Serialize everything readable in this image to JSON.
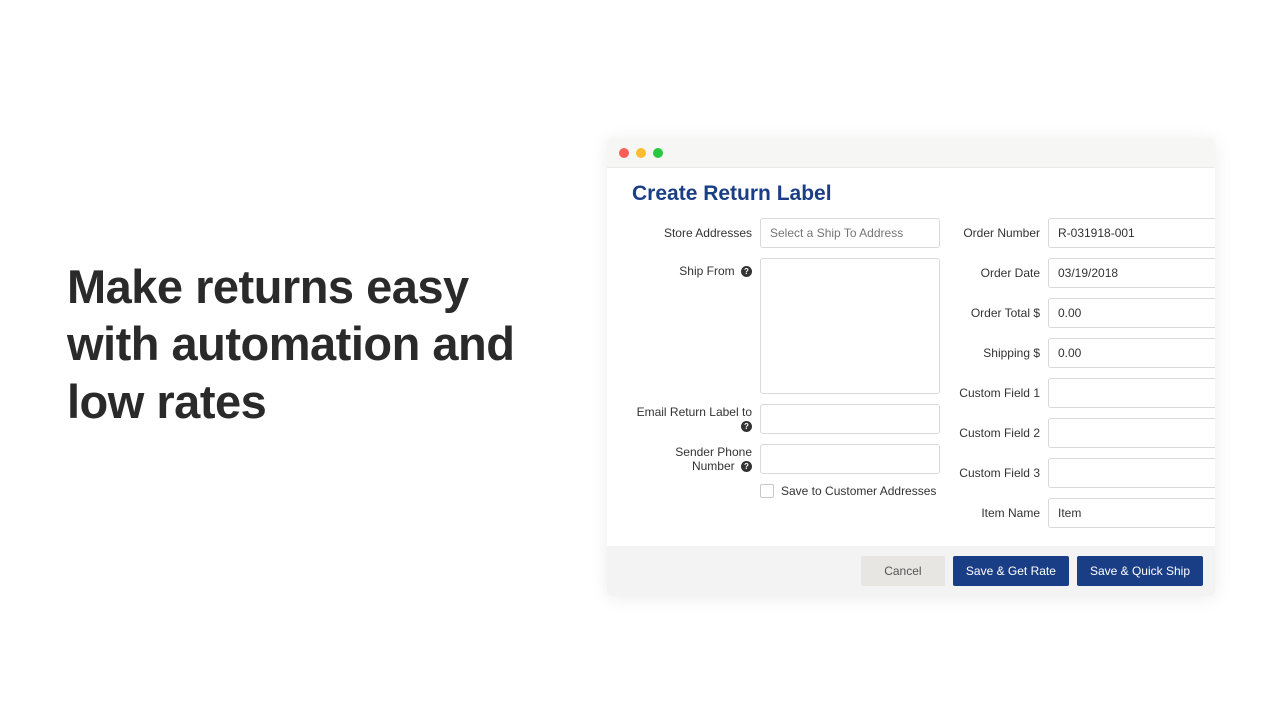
{
  "headline": "Make returns easy with automation and low rates",
  "form": {
    "title": "Create Return Label",
    "left": {
      "store_addresses_label": "Store Addresses",
      "store_addresses_placeholder": "Select a Ship To Address",
      "ship_from_label": "Ship From",
      "email_label": "Email Return Label to",
      "phone_label": "Sender Phone Number",
      "save_to_label": "Save to Customer Addresses"
    },
    "right": {
      "order_number_label": "Order Number",
      "order_number_value": "R-031918-001",
      "order_date_label": "Order Date",
      "order_date_value": "03/19/2018",
      "order_total_label": "Order Total $",
      "order_total_value": "0.00",
      "shipping_label": "Shipping $",
      "shipping_value": "0.00",
      "custom1_label": "Custom Field 1",
      "custom2_label": "Custom Field 2",
      "custom3_label": "Custom Field 3",
      "item_name_label": "Item Name",
      "item_name_value": "Item"
    },
    "buttons": {
      "cancel": "Cancel",
      "save_rate": "Save & Get Rate",
      "save_quick": "Save & Quick Ship"
    }
  }
}
